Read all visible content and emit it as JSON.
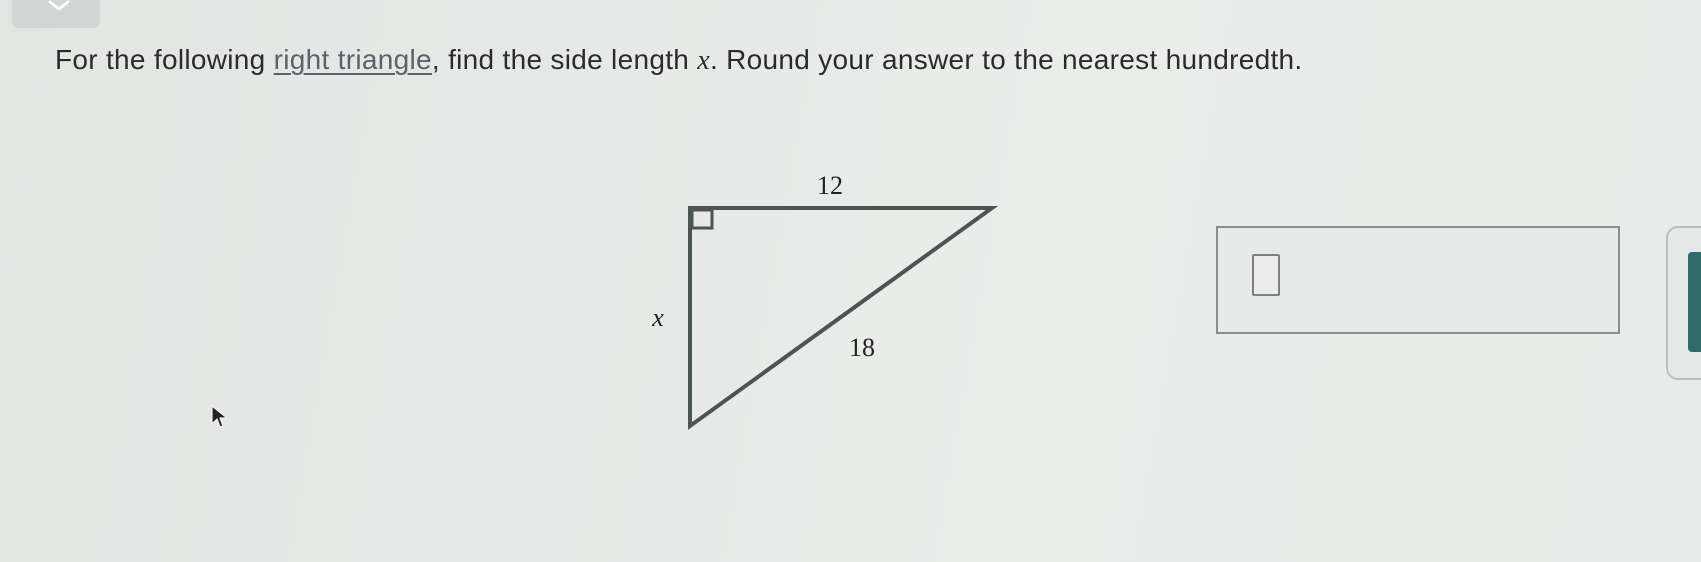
{
  "question": {
    "prefix": "For the following ",
    "link": "right triangle",
    "middle": ", find the side length ",
    "variable": "x",
    "suffix": ". Round your answer to the nearest hundredth."
  },
  "figure": {
    "top_side_label": "12",
    "left_side_label": "x",
    "hypotenuse_label": "18"
  },
  "answer": {
    "value": ""
  },
  "icons": {
    "top_tab": "chevron-down-icon",
    "cursor": "mouse-pointer-icon"
  }
}
